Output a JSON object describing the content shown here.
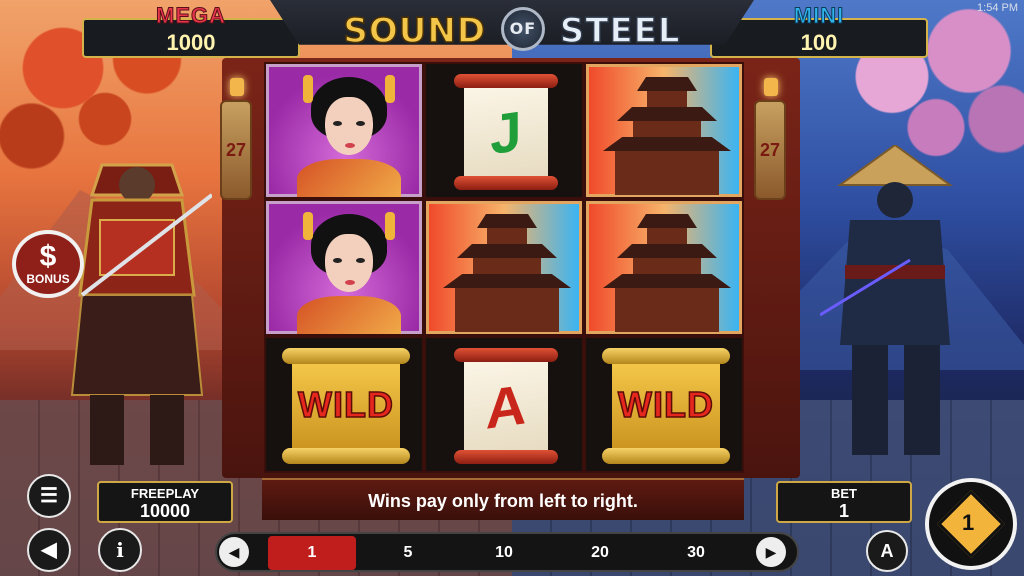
{
  "status": {
    "time": "1:54 PM"
  },
  "game": {
    "title_sound": "SOUND",
    "title_of": "OF",
    "title_steel": "STEEL"
  },
  "jackpots": {
    "mega": {
      "label": "MEGA",
      "value": "1000"
    },
    "mini": {
      "label": "MINI",
      "value": "100"
    }
  },
  "side_counters": {
    "left": "27",
    "right": "27"
  },
  "bonus": {
    "label": "BONUS",
    "symbol": "$"
  },
  "reels": [
    [
      "geisha",
      "scroll-J",
      "pagoda"
    ],
    [
      "geisha",
      "pagoda",
      "pagoda"
    ],
    [
      "wild",
      "scroll-A",
      "wild"
    ]
  ],
  "symbols": {
    "j_letter": "J",
    "a_letter": "A",
    "wild_text": "WILD"
  },
  "message": "Wins pay only from left to right.",
  "freeplay": {
    "label": "FREEPLAY",
    "value": "10000"
  },
  "bet": {
    "label": "BET",
    "value": "1"
  },
  "lines": [
    "1",
    "5",
    "10",
    "20",
    "30"
  ],
  "selected_line": "1",
  "controls": {
    "menu_icon": "menu-icon",
    "sound_icon": "speaker-icon",
    "info_icon": "info-icon",
    "auto_label": "A",
    "spin_label": "1"
  },
  "colors": {
    "mega": "#e8364b",
    "mini": "#2fb5ec",
    "active_line": "#c01d1d",
    "gold": "#cfa846"
  }
}
